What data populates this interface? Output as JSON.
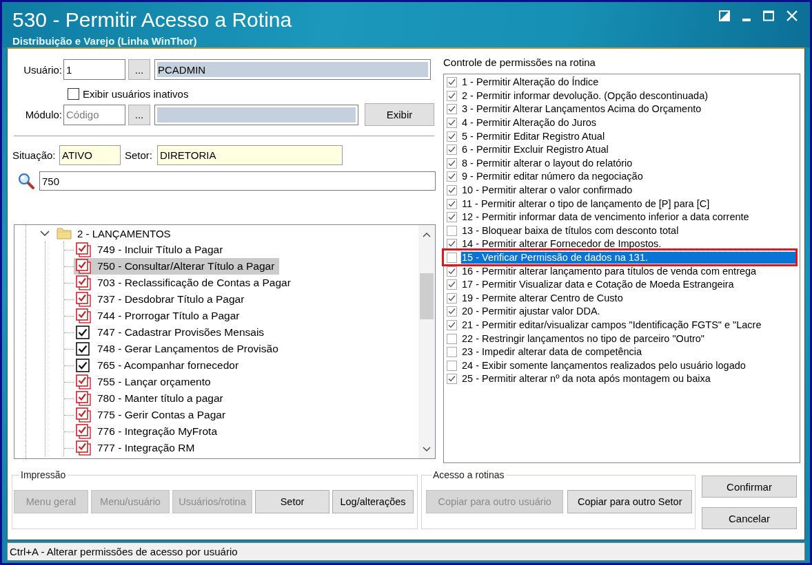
{
  "window": {
    "title": "530 - Permitir Acesso a Rotina",
    "subtitle": "Distribuição e Varejo (Linha WinThor)"
  },
  "user": {
    "label": "Usuário:",
    "code": "1",
    "browse": "...",
    "name": "PCADMIN"
  },
  "show_inactive": {
    "label": "Exibir usuários inativos",
    "checked": false
  },
  "module": {
    "label": "Módulo:",
    "placeholder": "Código",
    "browse": "...",
    "button": "Exibir"
  },
  "status_fields": [
    {
      "label": "Situação:",
      "value": "ATIVO"
    },
    {
      "label": "Setor:",
      "value": "DIRETORIA"
    }
  ],
  "search": {
    "value": "750"
  },
  "tree": {
    "label": "2 - LANÇAMENTOS",
    "expanded": true,
    "children": [
      {
        "label": "749 - Incluir Título a Pagar",
        "kind": "stacked",
        "checked": true,
        "selected": false
      },
      {
        "label": "750 - Consultar/Alterar Título a Pagar",
        "kind": "stacked",
        "checked": true,
        "selected": true
      },
      {
        "label": "703 - Reclassificação de Contas a Pagar",
        "kind": "stacked",
        "checked": true,
        "selected": false
      },
      {
        "label": "737 - Desdobrar Título a Pagar",
        "kind": "stacked",
        "checked": true,
        "selected": false
      },
      {
        "label": "744 - Prorrogar Título a Pagar",
        "kind": "stacked",
        "checked": true,
        "selected": false
      },
      {
        "label": "747 - Cadastrar Provisões Mensais",
        "kind": "plain",
        "checked": true,
        "selected": false
      },
      {
        "label": "748 - Gerar Lançamentos de Provisão",
        "kind": "plain",
        "checked": true,
        "selected": false
      },
      {
        "label": "765 - Acompanhar fornecedor",
        "kind": "plain",
        "checked": true,
        "selected": false
      },
      {
        "label": "755 - Lançar orçamento",
        "kind": "stacked",
        "checked": true,
        "selected": false
      },
      {
        "label": "780 - Manter título a pagar",
        "kind": "stacked",
        "checked": true,
        "selected": false
      },
      {
        "label": "775 - Gerir Contas a Pagar",
        "kind": "stacked",
        "checked": true,
        "selected": false
      },
      {
        "label": "776 - Integração MyFrota",
        "kind": "stacked",
        "checked": true,
        "selected": false
      },
      {
        "label": "777 - Integração RM",
        "kind": "stacked",
        "checked": true,
        "selected": false
      }
    ]
  },
  "permissions": {
    "title": "Controle de permissões na rotina",
    "items": [
      {
        "label": "1 - Permitir Alteração do Índice",
        "checked": true,
        "selected": false,
        "callout": false
      },
      {
        "label": "2 - Permitir informar devolução. (Opção descontinuada)",
        "checked": true,
        "selected": false,
        "callout": false
      },
      {
        "label": "3 - Permitir Alterar Lançamentos Acima do Orçamento",
        "checked": true,
        "selected": false,
        "callout": false
      },
      {
        "label": "4 - Permitir Alteração do Juros",
        "checked": true,
        "selected": false,
        "callout": false
      },
      {
        "label": "5 - Permitir Editar Registro Atual",
        "checked": true,
        "selected": false,
        "callout": false
      },
      {
        "label": "6 - Permitir Excluir Registro Atual",
        "checked": true,
        "selected": false,
        "callout": false
      },
      {
        "label": "8 - Permitir alterar o layout do relatório",
        "checked": true,
        "selected": false,
        "callout": false
      },
      {
        "label": "9 - Permitir editar número da negociação",
        "checked": true,
        "selected": false,
        "callout": false
      },
      {
        "label": "10 - Permitir alterar o valor confirmado",
        "checked": true,
        "selected": false,
        "callout": false
      },
      {
        "label": "11 - Permitir alterar o tipo de lançamento de [P] para [C]",
        "checked": true,
        "selected": false,
        "callout": false
      },
      {
        "label": "12 - Permitir informar data de vencimento inferior a data corrente",
        "checked": true,
        "selected": false,
        "callout": false
      },
      {
        "label": "13 - Bloquear baixa de títulos com desconto total",
        "checked": false,
        "selected": false,
        "callout": false
      },
      {
        "label": "14 - Permitir alterar Fornecedor de Impostos.",
        "checked": true,
        "selected": false,
        "callout": false
      },
      {
        "label": "15 - Verificar Permissão de dados na 131.",
        "checked": false,
        "selected": true,
        "callout": true
      },
      {
        "label": "16 - Permitir alterar lançamento para títulos de venda com entrega",
        "checked": true,
        "selected": false,
        "callout": false
      },
      {
        "label": "17 - Permitir Visualizar data e Cotação de Moeda Estrangeira",
        "checked": true,
        "selected": false,
        "callout": false
      },
      {
        "label": "19 - Permite alterar Centro de Custo",
        "checked": true,
        "selected": false,
        "callout": false
      },
      {
        "label": "20 - Permitir ajustar valor DDA.",
        "checked": true,
        "selected": false,
        "callout": false
      },
      {
        "label": "21 - Permitir editar/visualizar campos \"Identificação FGTS\" e \"Lacre",
        "checked": true,
        "selected": false,
        "callout": false
      },
      {
        "label": "22 - Restringir lançamentos no tipo de parceiro \"Outro\"",
        "checked": false,
        "selected": false,
        "callout": false
      },
      {
        "label": "23 - Impedir alterar data de competência",
        "checked": false,
        "selected": false,
        "callout": false
      },
      {
        "label": "24 - Exibir somente lançamentos realizados pelo usuário logado",
        "checked": false,
        "selected": false,
        "callout": false
      },
      {
        "label": "25 - Permitir alterar nº da nota após montagem ou baixa",
        "checked": true,
        "selected": false,
        "callout": false
      }
    ]
  },
  "print_group": {
    "title": "Impressão",
    "buttons": [
      {
        "label": "Menu geral",
        "disabled": true
      },
      {
        "label": "Menu/usuário",
        "disabled": true
      },
      {
        "label": "Usuários/rotina",
        "disabled": true
      },
      {
        "label": "Setor",
        "disabled": false
      },
      {
        "label": "Log/alterações",
        "disabled": false
      }
    ]
  },
  "access_group": {
    "title": "Acesso a rotinas",
    "buttons": [
      {
        "label": "Copiar para outro usuário",
        "disabled": true
      },
      {
        "label": "Copiar para outro Setor",
        "disabled": false
      }
    ]
  },
  "actions": [
    {
      "label": "Confirmar"
    },
    {
      "label": "Cancelar"
    }
  ],
  "status_bar": "Ctrl+A - Alterar permissões de acesso por usuário"
}
